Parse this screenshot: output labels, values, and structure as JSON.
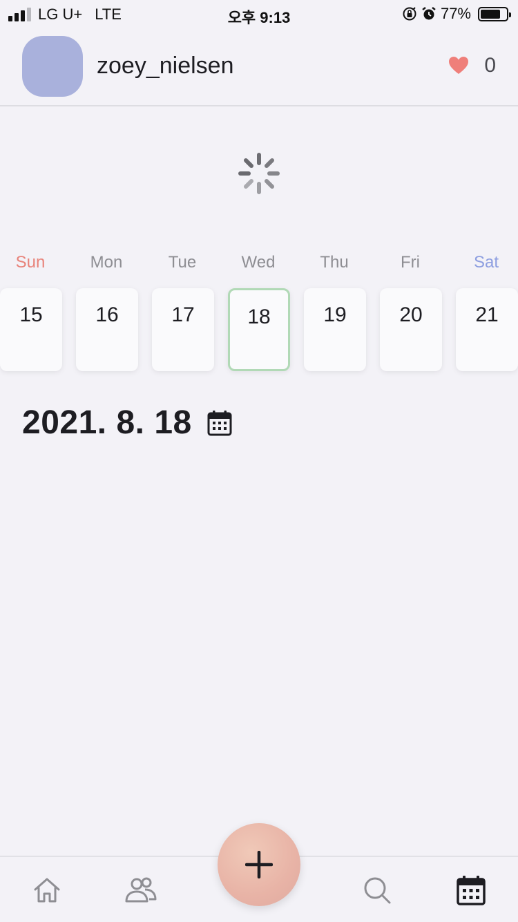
{
  "status_bar": {
    "carrier": "LG U+",
    "network": "LTE",
    "time": "오후 9:13",
    "battery_percent": "77%",
    "battery_level": 0.77
  },
  "header": {
    "username": "zoey_nielsen",
    "like_count": "0",
    "avatar_color": "#a9b1dc",
    "heart_color": "#ef7f7a"
  },
  "week": {
    "days": [
      {
        "name": "Sun",
        "date": "15"
      },
      {
        "name": "Mon",
        "date": "16"
      },
      {
        "name": "Tue",
        "date": "17"
      },
      {
        "name": "Wed",
        "date": "18"
      },
      {
        "name": "Thu",
        "date": "19"
      },
      {
        "name": "Fri",
        "date": "20"
      },
      {
        "name": "Sat",
        "date": "21"
      }
    ],
    "selected_date": "18",
    "sunday_color": "#e8837a",
    "saturday_color": "#8d9ee0",
    "selected_border_color": "#b1d9b6"
  },
  "main": {
    "date_heading": "2021. 8. 18",
    "loading": true
  },
  "bottom_nav": {
    "items": [
      {
        "icon": "home-icon"
      },
      {
        "icon": "friends-icon"
      },
      {
        "icon": "add-icon"
      },
      {
        "icon": "search-icon"
      },
      {
        "icon": "calendar-icon",
        "active": true
      }
    ]
  }
}
